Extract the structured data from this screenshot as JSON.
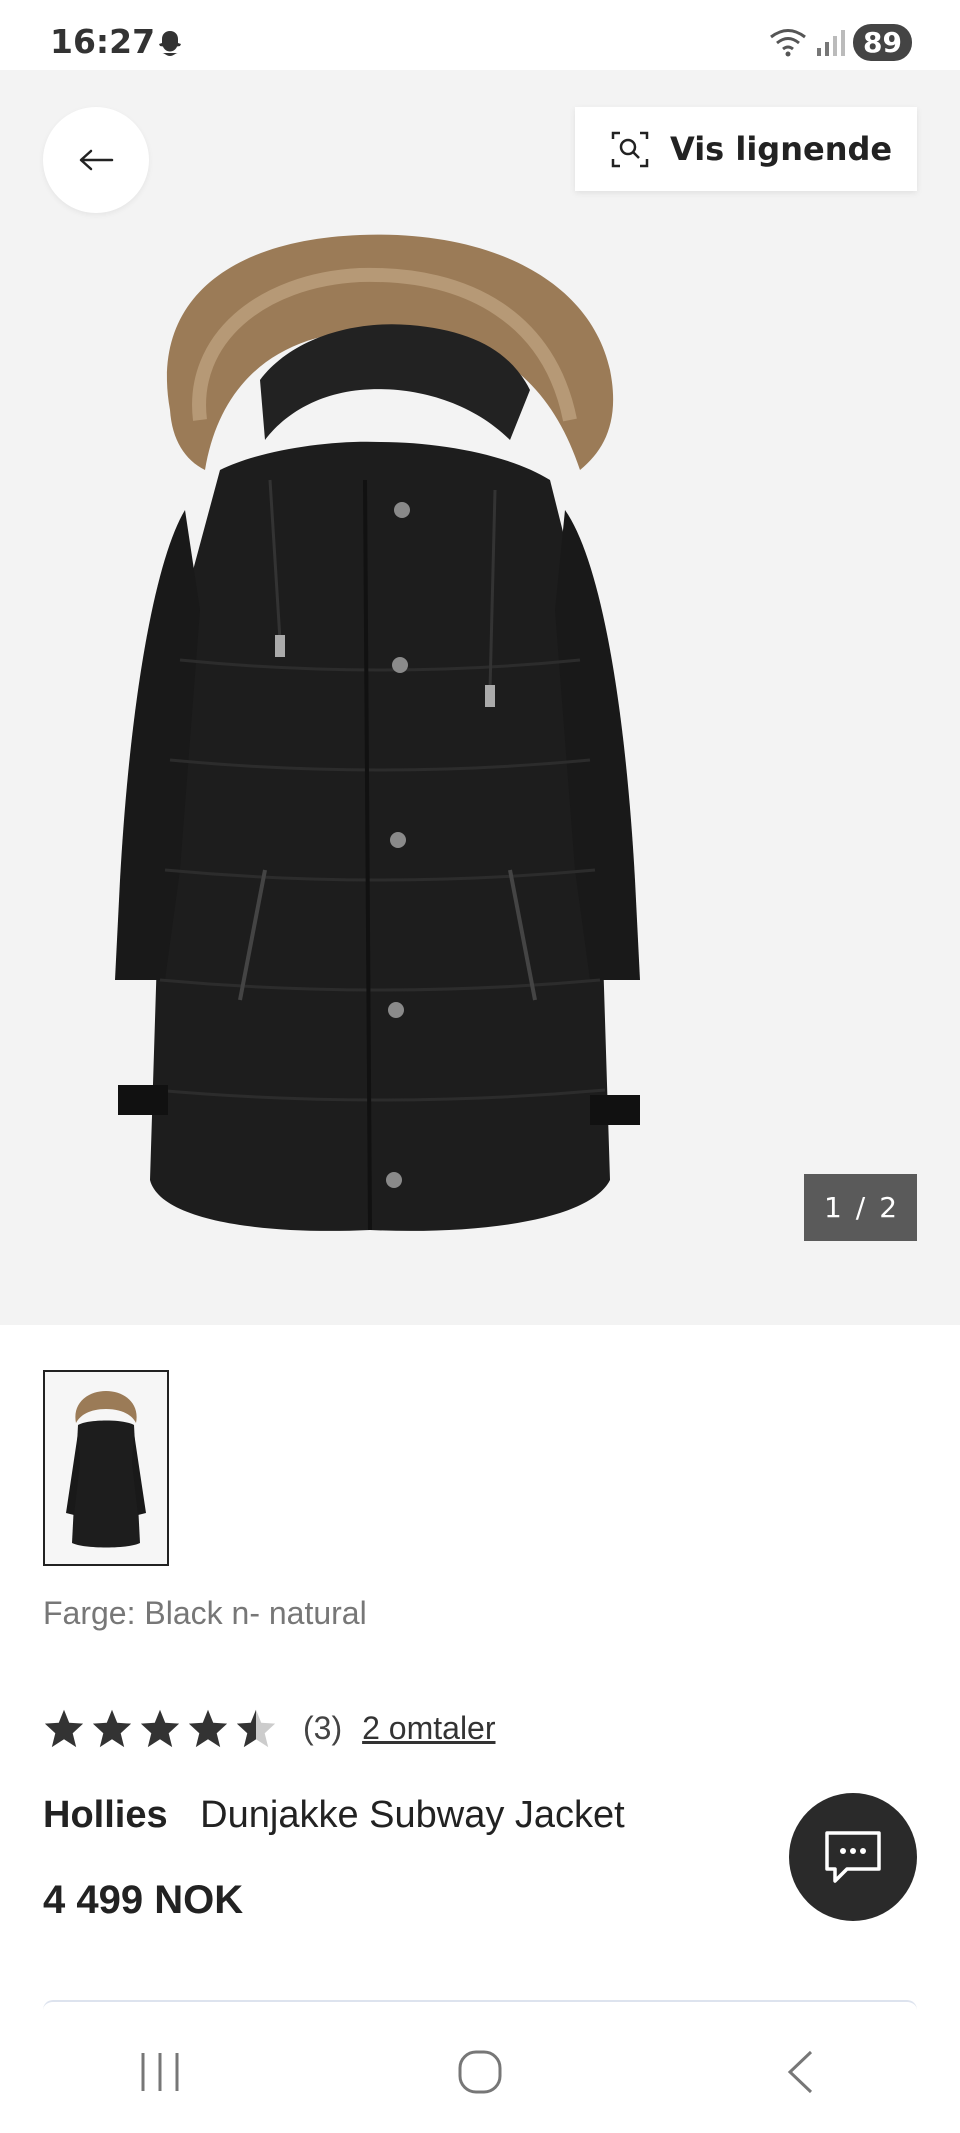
{
  "status_bar": {
    "time": "16:27",
    "battery": "89"
  },
  "hero": {
    "similar_button_label": "Vis lignende",
    "image_counter": {
      "current": "1",
      "separator": "/",
      "total": "2"
    }
  },
  "product": {
    "color_label": "Farge: Black n- natural",
    "rating": {
      "value": 4.5,
      "max": 5,
      "count_label": "(3)",
      "reviews_link": "2 omtaler"
    },
    "brand": "Hollies",
    "name": "Dunjakke Subway Jacket",
    "price": "4 499 NOK"
  },
  "icons": {
    "back": "arrow-left-icon",
    "similar": "visual-search-icon",
    "chat": "chat-icon",
    "snapchat": "snapchat-ghost-icon",
    "wifi": "wifi-icon",
    "signal": "signal-icon"
  },
  "colors": {
    "hero_bg": "#f3f3f3",
    "counter_bg": "#5a5a5a",
    "fab_bg": "#2a2a2a",
    "text": "#222222",
    "muted": "#777777"
  }
}
